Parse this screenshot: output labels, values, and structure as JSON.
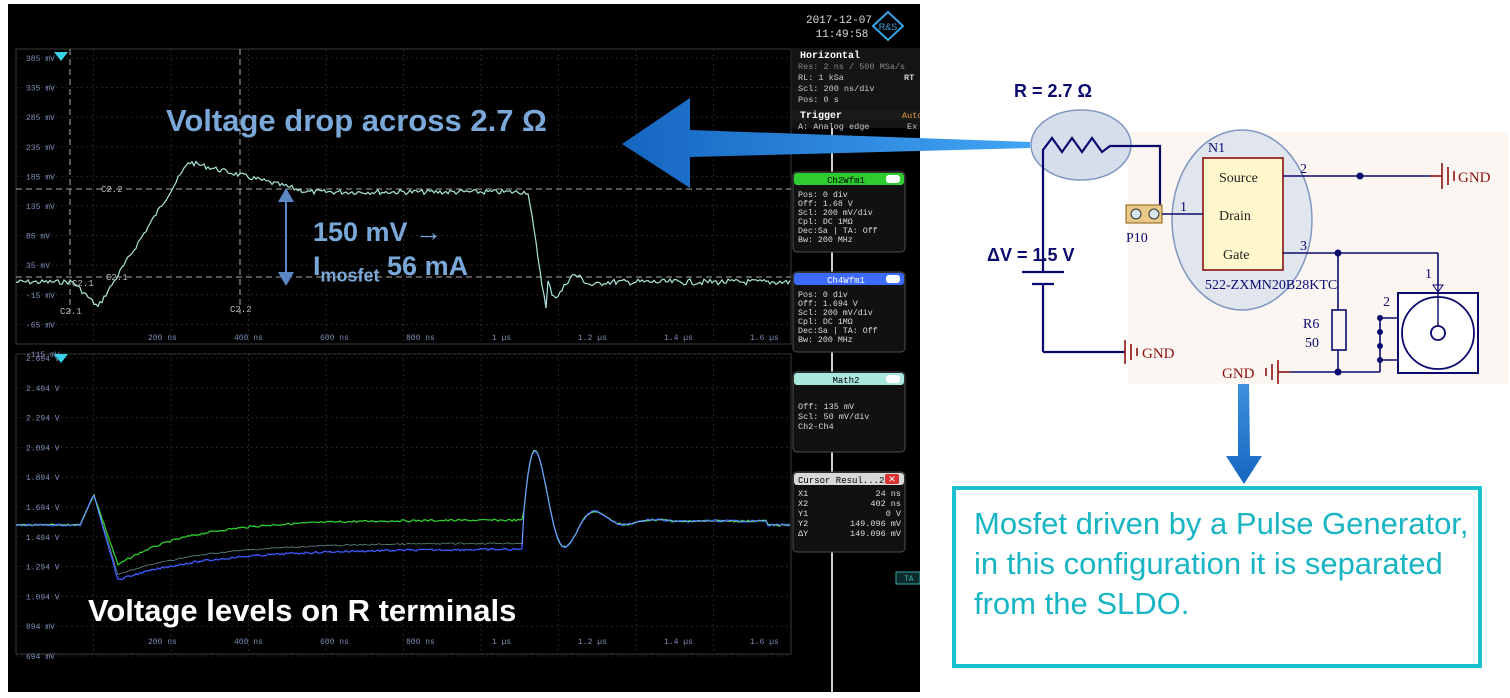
{
  "scope": {
    "date": "2017-12-07",
    "time": "11:49:58",
    "logo": "R&S",
    "upper_y_ticks": [
      "385 mV",
      "335 mV",
      "285 mV",
      "235 mV",
      "185 mV",
      "135 mV",
      "85 mV",
      "35 mV",
      "-15 mV",
      "-65 mV",
      "-115 mV"
    ],
    "lower_y_ticks": [
      "2.694 V",
      "2.494 V",
      "2.294 V",
      "2.094 V",
      "1.894 V",
      "1.694 V",
      "1.494 V",
      "1.294 V",
      "1.094 V",
      "894 mV",
      "694 mV"
    ],
    "x_ticks": [
      "200 ns",
      "400 ns",
      "600 ns",
      "800 ns",
      "1 µs",
      "1.2 µs",
      "1.4 µs",
      "1.6 µs"
    ],
    "cursor_labels": {
      "c21_a": "C2.1",
      "c21_b": "C2.1",
      "c21_c": "C2.1",
      "c22_a": "C2.2",
      "c22_b": "C2.2"
    },
    "horizontal_panel": {
      "title": "Horizontal",
      "lines": [
        "Res: 2 ns / 500 MSa/s",
        "RL:  1 kSa",
        "Scl:  200 ns/div",
        "Pos: 0 s"
      ],
      "rt": "RT"
    },
    "trigger_panel": {
      "title": "Trigger",
      "mode": "Auto",
      "line": "A:   Analog edge",
      "ext": "Ex"
    },
    "ch2_panel": {
      "title": "Ch2Wfm1",
      "lines": [
        "Pos: 0 div",
        "Off: 1.68 V",
        "Scl: 200 mV/div",
        "Cpl: DC 1MΩ",
        "Dec:Sa | TA: Off",
        "Bw: 200 MHz"
      ]
    },
    "ch4_panel": {
      "title": "Ch4Wfm1",
      "lines": [
        "Pos: 0 div",
        "Off: 1.694 V",
        "Scl: 200 mV/div",
        "Cpl: DC 1MΩ",
        "Dec:Sa | TA: Off",
        "Bw: 200 MHz"
      ]
    },
    "math_panel": {
      "title": "Math2",
      "lines": [
        "Off: 135 mV",
        "Scl: 50 mV/div",
        "Ch2-Ch4"
      ]
    },
    "cursor_panel": {
      "title": "Cursor Resul...2",
      "rows": [
        [
          "X1",
          "24 ns"
        ],
        [
          "X2",
          "402 ns"
        ],
        [
          "Y1",
          "0 V"
        ],
        [
          "Y2",
          "149.096 mV"
        ],
        [
          "ΔY",
          "149.096 mV"
        ]
      ]
    },
    "ta_tag": "TA"
  },
  "annotations": {
    "voltage_drop": "Voltage drop across 2.7 Ω",
    "delta_line1": "150 mV →",
    "delta_I": "I",
    "delta_sub": "mosfet",
    "delta_val": " 56 mA",
    "voltage_levels": "Voltage levels on R terminals"
  },
  "circuit": {
    "r_label": "R = 2.7 Ω",
    "dv_label": "ΔV = 1.5 V",
    "n1": "N1",
    "source": "Source",
    "drain": "Drain",
    "gate": "Gate",
    "pin2": "2",
    "pin1": "1",
    "pin3": "3",
    "part": "522-ZXMN20B28KTC",
    "p10": "P10",
    "gnd1": "GND",
    "gnd2": "GND",
    "gnd3": "GND",
    "r6": "R6",
    "r6_val": "50",
    "conn_pin2": "2",
    "conn_pin1": "1"
  },
  "note": {
    "text": "Mosfet driven by a Pulse Generator, in this configuration it is separated from the SLDO."
  },
  "colors": {
    "arrow": "#1e88e5",
    "note_border": "#19c2cc",
    "note_text": "#19b5c4",
    "trace_green": "#2ecc2e",
    "trace_blue": "#3d5bff",
    "trace_cyan": "#a9e6dc",
    "schematic_red": "#8b1010",
    "schematic_navy": "#0a0a6e"
  }
}
